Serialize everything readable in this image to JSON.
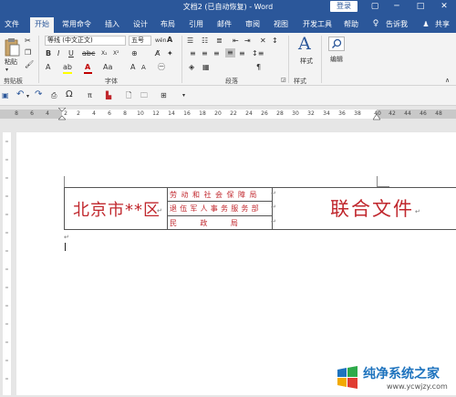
{
  "titlebar": {
    "title": "文档2 (已自动恢复) - Word",
    "login_label": "登录",
    "controls": [
      "▢",
      "─",
      "□",
      "✕"
    ]
  },
  "tabs": [
    {
      "label": "文件",
      "active": false
    },
    {
      "label": "开始",
      "active": true
    },
    {
      "label": "常用命令",
      "active": false
    },
    {
      "label": "插入",
      "active": false
    },
    {
      "label": "设计",
      "active": false
    },
    {
      "label": "布局",
      "active": false
    },
    {
      "label": "引用",
      "active": false
    },
    {
      "label": "邮件",
      "active": false
    },
    {
      "label": "审阅",
      "active": false
    },
    {
      "label": "视图",
      "active": false
    },
    {
      "label": "开发工具",
      "active": false
    },
    {
      "label": "帮助",
      "active": false
    }
  ],
  "tell_me": "告诉我",
  "share": "共享",
  "ribbon": {
    "clipboard": {
      "paste_label": "粘贴",
      "group_label": "剪贴板"
    },
    "font": {
      "font_name": "等线 (中文正文)",
      "font_size": "五号",
      "group_label": "字体",
      "char_size_glyph": "wén",
      "font_color": "#c00000",
      "highlight_color": "#ffff00"
    },
    "paragraph": {
      "group_label": "段落"
    },
    "styles": {
      "label": "样式",
      "group_label": "样式"
    },
    "editing": {
      "label": "编辑"
    }
  },
  "ruler": {
    "ticks": [
      "8",
      "6",
      "4",
      "2",
      "",
      "2",
      "4",
      "6",
      "8",
      "10",
      "12",
      "14",
      "16",
      "18",
      "20",
      "22",
      "24",
      "26",
      "28",
      "30",
      "32",
      "34",
      "36",
      "38",
      "40",
      "42",
      "44",
      "46",
      "48"
    ]
  },
  "document": {
    "city": "北京市**区",
    "departments": [
      "劳动和社会保障局",
      "退伍军人事务服务部",
      "民          政          局"
    ],
    "joint_title": "联合文件",
    "paragraph_mark": "↵",
    "accent_color": "#c0272d"
  },
  "watermark": {
    "brand": "纯净系统之家",
    "url": "www.ycwjzy.com",
    "colors": [
      "#1e73be",
      "#2eaa4a",
      "#f2a900",
      "#e03c31"
    ]
  }
}
